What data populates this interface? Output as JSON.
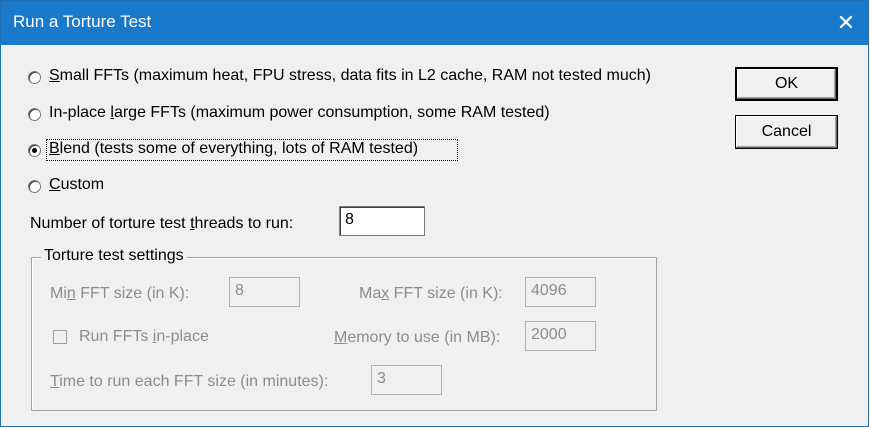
{
  "window": {
    "title": "Run a Torture Test",
    "close_glyph": "✕"
  },
  "options": {
    "small_ffts": {
      "mnemonic": "S",
      "rest": "mall FFTs (maximum heat, FPU stress, data fits in L2 cache, RAM not tested much)",
      "selected": false
    },
    "inplace_large": {
      "pre": "In-place ",
      "mnemonic": "l",
      "rest": "arge FFTs (maximum power consumption, some RAM tested)",
      "selected": false
    },
    "blend": {
      "mnemonic": "B",
      "rest": "lend (tests some of everything, lots of RAM tested)",
      "selected": true
    },
    "custom": {
      "mnemonic": "C",
      "rest": "ustom",
      "selected": false
    }
  },
  "threads": {
    "pre": "Number of torture test ",
    "mnemonic": "t",
    "rest": "hreads to run:",
    "value": "8"
  },
  "settings": {
    "legend": "Torture test settings",
    "min_fft": {
      "pre": "Mi",
      "mnemonic": "n",
      "rest": " FFT size (in K):",
      "value": "8"
    },
    "max_fft": {
      "pre": "Ma",
      "mnemonic": "x",
      "rest": " FFT size (in K):",
      "value": "4096"
    },
    "run_inplace": {
      "pre": "Run FFTs ",
      "mnemonic": "i",
      "rest": "n-place",
      "checked": false
    },
    "memory": {
      "mnemonic": "M",
      "rest": "emory to use (in MB):",
      "value": "2000"
    },
    "time": {
      "mnemonic": "T",
      "rest": "ime to run each FFT size (in minutes):",
      "value": "3"
    }
  },
  "buttons": {
    "ok": "OK",
    "cancel": "Cancel"
  }
}
